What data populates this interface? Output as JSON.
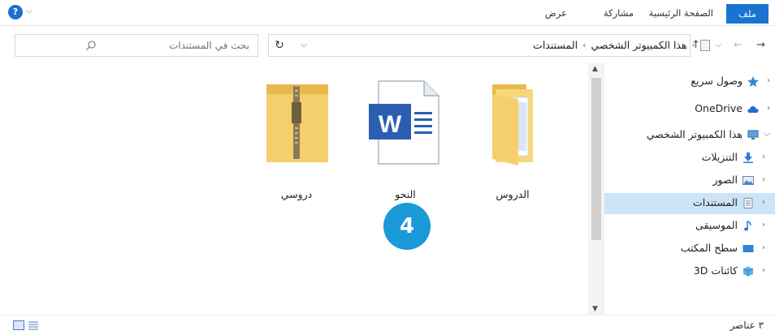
{
  "ribbon": {
    "help": "?",
    "tabs": {
      "file": "ملف",
      "home": "الصفحة الرئيسية",
      "share": "مشاركة",
      "view": "عرض"
    }
  },
  "address": {
    "breadcrumb": [
      "هذا الكمبيوتر الشخصي",
      "المستندات"
    ],
    "separator": "›",
    "search_placeholder": "بحث في المستندات"
  },
  "files": [
    {
      "name": "الدروس",
      "type": "folder"
    },
    {
      "name": "النحو",
      "type": "word-document"
    },
    {
      "name": "دروسي",
      "type": "zip-folder"
    }
  ],
  "badge": "4",
  "nav": [
    {
      "label": "وصول سريع",
      "icon": "star-icon"
    },
    {
      "label": "OneDrive",
      "icon": "cloud-icon"
    },
    {
      "label": "هذا الكمبيوتر الشخصي",
      "icon": "computer-icon"
    },
    {
      "label": "التنزيلات",
      "icon": "download-icon"
    },
    {
      "label": "الصور",
      "icon": "pictures-icon"
    },
    {
      "label": "المستندات",
      "icon": "documents-icon"
    },
    {
      "label": "الموسيقى",
      "icon": "music-icon"
    },
    {
      "label": "سطح المكتب",
      "icon": "desktop-icon"
    },
    {
      "label": "كائنات 3D",
      "icon": "3d-objects-icon"
    }
  ],
  "status": {
    "count": "٣ عناصر"
  },
  "colors": {
    "accent": "#1a73d1",
    "selected": "#cce4f7",
    "badge": "#1a9ad6",
    "folder": "#f4cf6b"
  }
}
